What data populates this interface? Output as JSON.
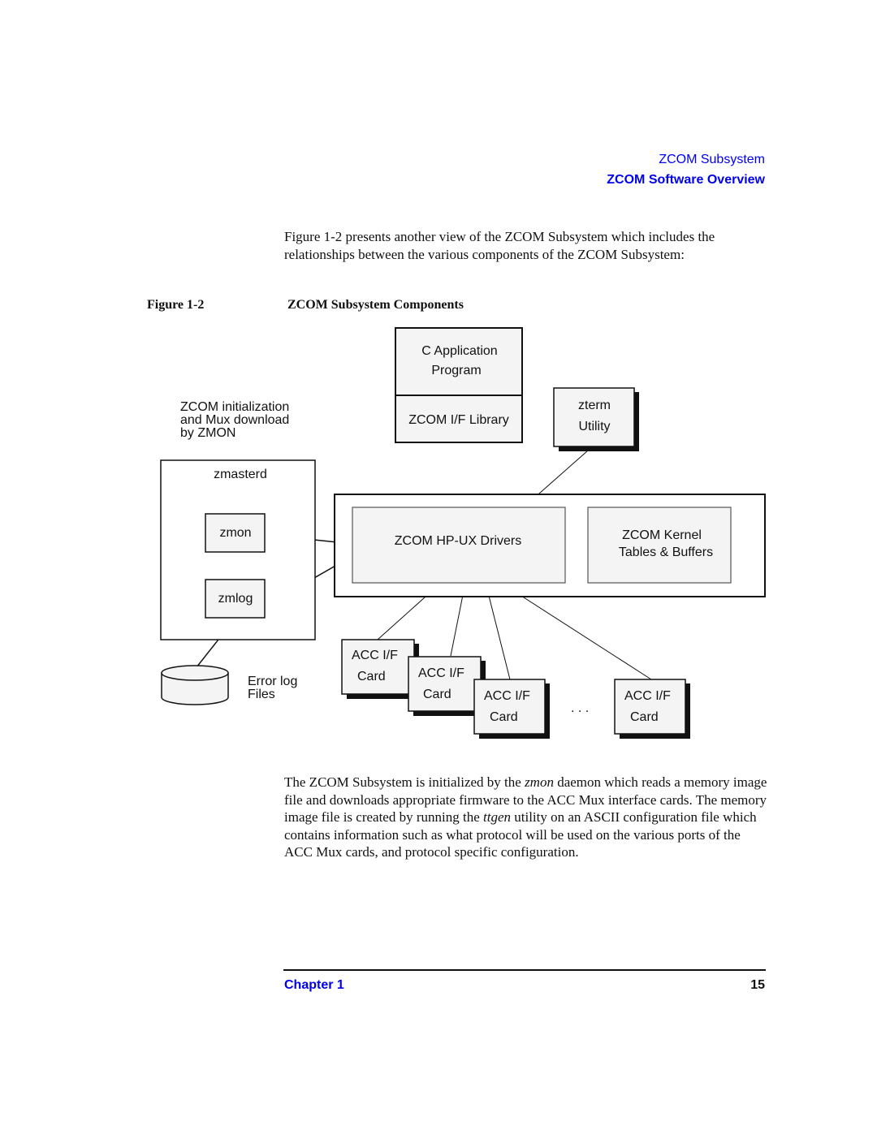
{
  "header": {
    "section": "ZCOM Subsystem",
    "title": "ZCOM Software Overview"
  },
  "intro_paragraph": "Figure 1-2 presents another view of the ZCOM Subsystem which includes the relationships between the various components of the ZCOM Subsystem:",
  "figure": {
    "label": "Figure 1-2",
    "title": "ZCOM Subsystem Components",
    "nodes": {
      "c_app_line1": "C Application",
      "c_app_line2": "Program",
      "if_library": "ZCOM I/F Library",
      "zterm_line1": "zterm",
      "zterm_line2": "Utility",
      "init_note_line1": "ZCOM initialization",
      "init_note_line2": "and Mux download",
      "init_note_line3": "by ZMON",
      "zmasterd": "zmasterd",
      "zmon": "zmon",
      "zmlog": "zmlog",
      "hpux_drivers": "ZCOM HP-UX Drivers",
      "kernel_line1": "ZCOM Kernel",
      "kernel_line2": "Tables & Buffers",
      "error_log_line1": "Error log",
      "error_log_line2": "Files",
      "card_line1": "ACC I/F",
      "card_line2": "Card",
      "ellipsis": ". . ."
    }
  },
  "outro": {
    "part1": "The ZCOM Subsystem is initialized by the ",
    "zmon": "zmon",
    "part2": " daemon which reads a memory image file and downloads appropriate firmware to the ACC Mux interface cards. The memory image file is created by running the ",
    "ttgen": "ttgen",
    "part3": " utility on an ASCII configuration file which contains information such as what protocol will be used on the various ports of the ACC Mux cards, and protocol specific configuration."
  },
  "footer": {
    "chapter": "Chapter 1",
    "page": "15"
  },
  "colors": {
    "link_blue": "#0000ee",
    "box_fill": "#f4f4f4",
    "ink": "#111111"
  }
}
